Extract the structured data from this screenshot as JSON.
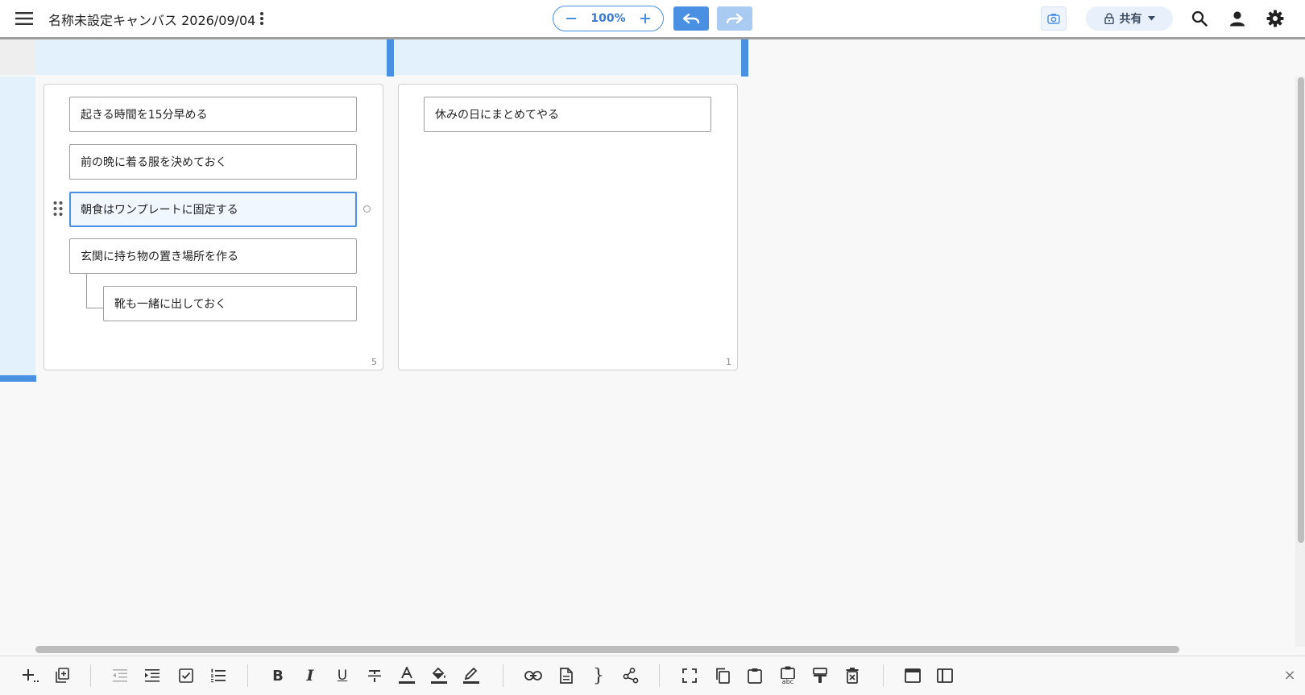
{
  "header": {
    "title": "名称未設定キャンバス 2026/09/04",
    "zoom": "100%",
    "share_label": "共有"
  },
  "columns": [
    {
      "cards": [
        "起きる時間を15分早める",
        "前の晩に着る服を決めておく",
        "朝食はワンプレートに固定する",
        "玄関に持ち物の置き場所を作る",
        "靴も一緒に出しておく"
      ],
      "count": "5",
      "selected_card_index": 2,
      "child_of_card_index": {
        "4": 3
      }
    },
    {
      "cards": [
        "休みの日にまとめてやる"
      ],
      "count": "1"
    }
  ],
  "toolbar": {
    "icons": [
      "add-card-icon",
      "duplicate-card-icon",
      "outdent-icon",
      "indent-icon",
      "checkbox-icon",
      "numbered-list-icon",
      "bold-icon",
      "italic-icon",
      "underline-icon",
      "strikethrough-icon",
      "text-color-icon",
      "fill-color-icon",
      "highlighter-icon",
      "link-icon",
      "note-icon",
      "brace-icon",
      "connect-icon",
      "fullscreen-icon",
      "copy-icon",
      "paste-icon",
      "paste-text-icon",
      "format-painter-icon",
      "delete-icon",
      "window-icon",
      "sidebar-icon"
    ],
    "bold_glyph": "B",
    "italic_glyph": "I",
    "underline_glyph": "U",
    "text_color_glyph": "A",
    "brace_glyph": "}",
    "paste_text_glyph": "abc",
    "close_glyph": "×"
  },
  "colors": {
    "accent": "#4a90e2",
    "accent_light": "#a9cbf1",
    "header_band": "#e3f1fc"
  }
}
